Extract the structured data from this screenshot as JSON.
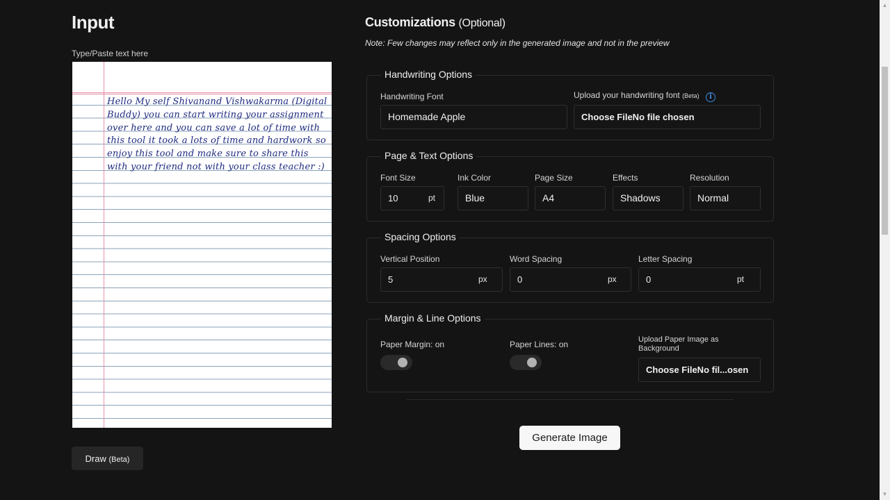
{
  "input": {
    "title": "Input",
    "type_label": "Type/Paste text here",
    "paper_text": "Hello My self Shivanand Vishwakarma (Digital Buddy) you can start writing your assignment over here and you can save a lot of time with this tool it took a lots of time and hardwork so enjoy this tool and make sure to share this with your friend not with your class teacher :)",
    "draw_label": "Draw",
    "draw_badge": "(Beta)",
    "ink_color": "#1e2a80"
  },
  "customizations": {
    "title": "Customizations",
    "optional": "(Optional)",
    "note": "Note: Few changes may reflect only in the generated image and not in the preview"
  },
  "handwriting": {
    "legend": "Handwriting Options",
    "font_label": "Handwriting Font",
    "font_value": "Homemade Apple",
    "upload_label": "Upload your handwriting font",
    "upload_badge": "(Beta)",
    "upload_value": "Choose FileNo file chosen"
  },
  "page_text": {
    "legend": "Page & Text Options",
    "font_size_label": "Font Size",
    "font_size_value": "10",
    "font_size_unit": "pt",
    "ink_color_label": "Ink Color",
    "ink_color_value": "Blue",
    "page_size_label": "Page Size",
    "page_size_value": "A4",
    "effects_label": "Effects",
    "effects_value": "Shadows",
    "resolution_label": "Resolution",
    "resolution_value": "Normal"
  },
  "spacing": {
    "legend": "Spacing Options",
    "vertical_label": "Vertical Position",
    "vertical_value": "5",
    "vertical_unit": "px",
    "word_label": "Word Spacing",
    "word_value": "0",
    "word_unit": "px",
    "letter_label": "Letter Spacing",
    "letter_value": "0",
    "letter_unit": "pt"
  },
  "margin_lines": {
    "legend": "Margin & Line Options",
    "margin_label": "Paper Margin: on",
    "lines_label": "Paper Lines: on",
    "upload_label": "Upload Paper Image as Background",
    "upload_value": "Choose FileNo fil...osen"
  },
  "generate_label": "Generate Image"
}
